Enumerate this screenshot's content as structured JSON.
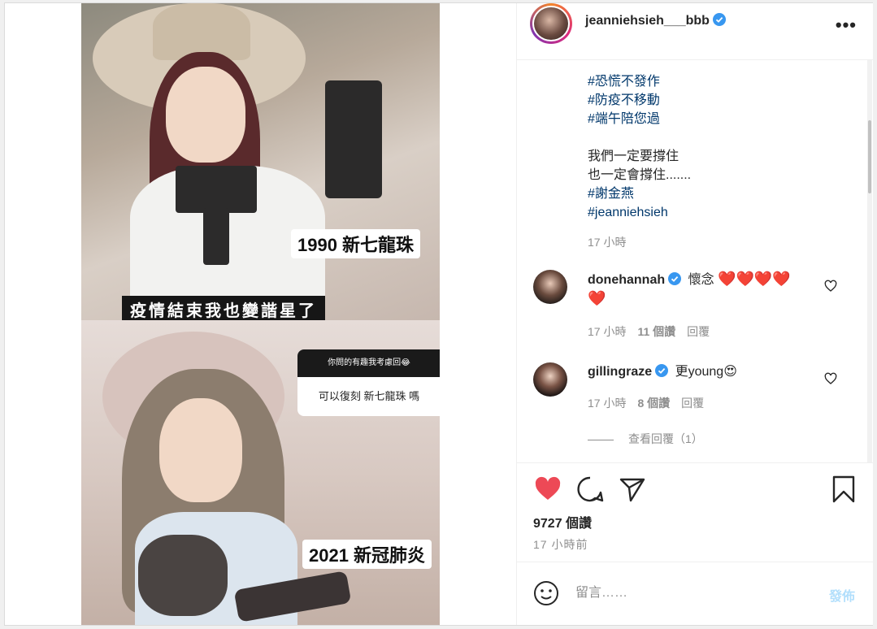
{
  "post": {
    "username": "jeanniehsieh___bbb",
    "image_captions": {
      "top_label": "1990 新七龍珠",
      "middle_banner": "疫情結束我也變諧星了",
      "question_header": "你問的有趣我考慮回😂",
      "question_text": "可以復刻 新七龍珠 嗎",
      "bottom_label": "2021 新冠肺炎"
    }
  },
  "caption": {
    "lines": [
      {
        "text": "#恐慌不發作",
        "type": "hashtag"
      },
      {
        "text": "#防疫不移動",
        "type": "hashtag"
      },
      {
        "text": "#端午陪您過",
        "type": "hashtag"
      },
      {
        "text": "",
        "type": "blank"
      },
      {
        "text": "我們一定要撐住",
        "type": "text"
      },
      {
        "text": "也一定會撐住.......",
        "type": "text"
      },
      {
        "text": "#謝金燕",
        "type": "hashtag"
      },
      {
        "text": "#jeanniehsieh",
        "type": "hashtag"
      }
    ],
    "time": "17 小時"
  },
  "comments": [
    {
      "user": "donehannah",
      "text": "懷念",
      "hearts": "❤️❤️❤️❤️",
      "hearts2": "❤️",
      "time": "17 小時",
      "likes": "11 個讚",
      "reply": "回覆"
    },
    {
      "user": "gillingraze",
      "text": "更young",
      "emoji": "😍",
      "time": "17 小時",
      "likes": "8 個讚",
      "reply": "回覆"
    }
  ],
  "view_replies": "查看回覆（1）",
  "actions": {
    "likes": "9727 個讚",
    "posted": "17 小時前"
  },
  "comment_box": {
    "placeholder": "留言……",
    "post_label": "發佈"
  },
  "colors": {
    "like_red": "#ed4956",
    "verified_blue": "#3897f0",
    "hashtag": "#00376b",
    "post_disabled": "#b2dffc"
  },
  "icons": [
    "more-icon",
    "verified-icon",
    "heart-icon",
    "comment-icon",
    "share-icon",
    "bookmark-icon",
    "emoji-icon"
  ]
}
